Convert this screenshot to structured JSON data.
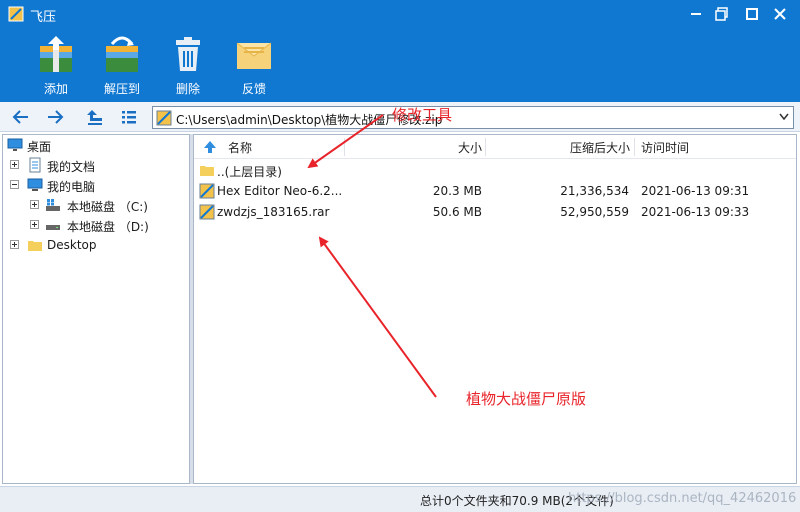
{
  "window": {
    "title": "飞压",
    "minimize_icon": "minimize-icon",
    "maximize_icon": "maximize-icon",
    "close_icon": "close-icon"
  },
  "toolbar": {
    "add_label": "添加",
    "extract_label": "解压到",
    "delete_label": "删除",
    "feedback_label": "反馈"
  },
  "nav": {
    "path": "C:\\Users\\admin\\Desktop\\植物大战僵尸修改.zip"
  },
  "tree": {
    "desktop": "桌面",
    "my_documents": "我的文档",
    "my_computer": "我的电脑",
    "disk_c": "本地磁盘 （C:)",
    "disk_d": "本地磁盘 （D:)",
    "desktop_folder": "Desktop"
  },
  "filelist": {
    "columns": [
      "名称",
      "大小",
      "压缩后大小",
      "访问时间"
    ],
    "parent_dir": "..(上层目录)",
    "rows": [
      {
        "name": "Hex Editor Neo-6.2...",
        "size": "20.3 MB",
        "packed": "21,336,534",
        "time": "2021-06-13 09:31"
      },
      {
        "name": "zwdzjs_183165.rar",
        "size": "50.6 MB",
        "packed": "52,950,559",
        "time": "2021-06-13 09:33"
      }
    ]
  },
  "status": {
    "summary": "总计0个文件夹和70.9 MB(2个文件)",
    "watermark": "https://blog.csdn.net/qq_42462016"
  },
  "annotations": {
    "tool_note": "修改工具",
    "original_note": "植物大战僵尸原版",
    "color": "#e8242a"
  },
  "colors": {
    "titlebar": "#1178d2",
    "accent": "#1178d2"
  }
}
